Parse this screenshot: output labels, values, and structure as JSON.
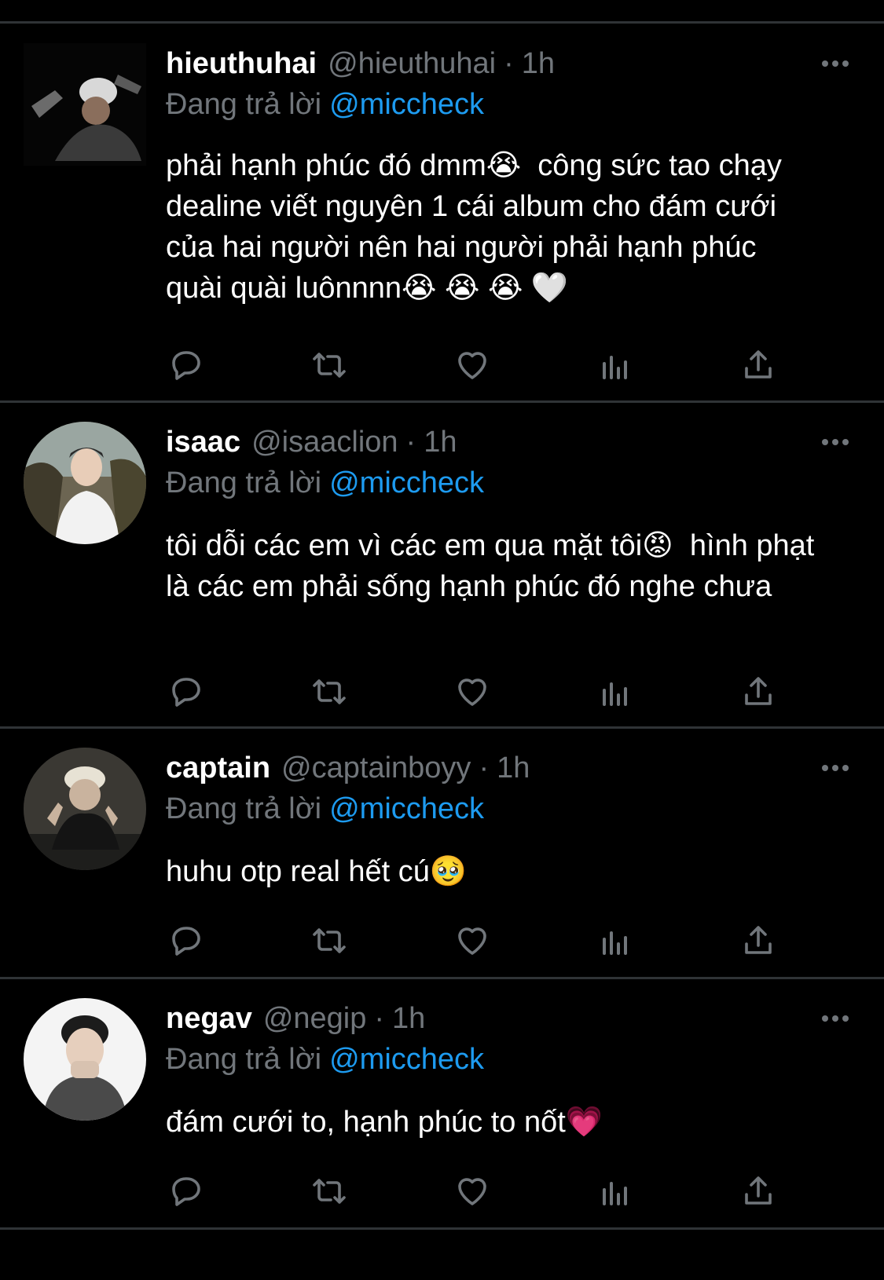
{
  "reply_prefix": "Đang trả lời",
  "tweets": [
    {
      "display_name": "hieuthuhai",
      "handle": "@hieuthuhai",
      "separator": "·",
      "time": "1h",
      "replying_to": "@miccheck",
      "text": "phải hạnh phúc đó dmm😭  công sức tao chạy dealine viết nguyên 1 cái album cho đám cưới của hai người nên hai người phải hạnh phúc quài quài luônnnn😭 😭 😭 🤍",
      "avatar_icon": "avatar-photo-icon"
    },
    {
      "display_name": "isaac",
      "handle": "@isaaclion",
      "separator": "·",
      "time": "1h",
      "replying_to": "@miccheck",
      "text": "tôi dỗi các em vì các em qua mặt tôi😡  hình phạt là các em phải sống hạnh phúc đó nghe chưa",
      "avatar_icon": "avatar-photo-icon"
    },
    {
      "display_name": "captain",
      "handle": "@captainboyy",
      "separator": "·",
      "time": "1h",
      "replying_to": "@miccheck",
      "text": "huhu otp real hết cú🥹",
      "avatar_icon": "avatar-photo-icon"
    },
    {
      "display_name": "negav",
      "handle": "@negip",
      "separator": "·",
      "time": "1h",
      "replying_to": "@miccheck",
      "text": "đám cưới to, hạnh phúc to nốt💗",
      "avatar_icon": "avatar-photo-icon"
    }
  ],
  "action_icons": [
    "reply-icon",
    "retweet-icon",
    "like-icon",
    "views-icon",
    "share-icon"
  ],
  "colors": {
    "background": "#000000",
    "divider": "#2f3336",
    "secondary_text": "#71767b",
    "mention": "#1d9bf0",
    "primary_text": "#ffffff"
  }
}
